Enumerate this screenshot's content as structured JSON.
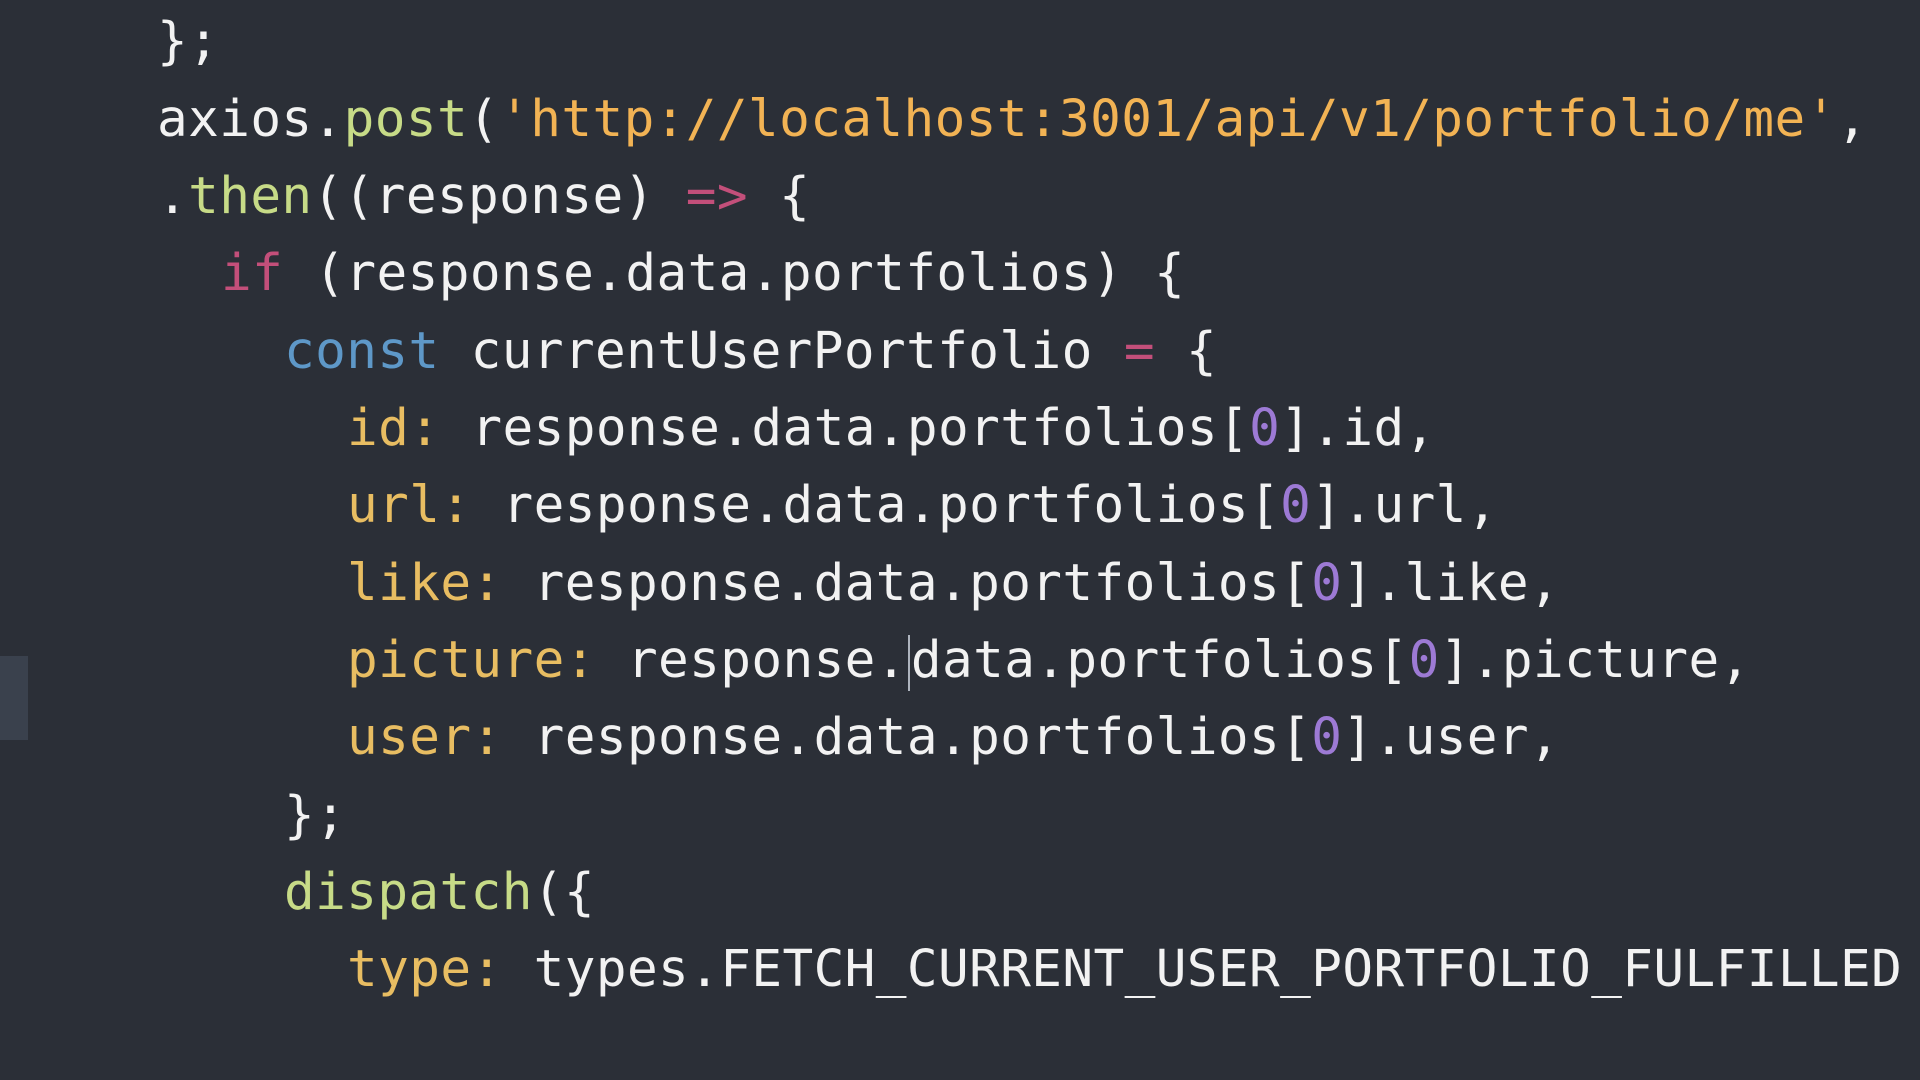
{
  "editor": {
    "name": "code-editor",
    "lines": [
      {
        "tokens": [
          {
            "t": "};",
            "c": "plain"
          }
        ]
      },
      {
        "tokens": [
          {
            "t": "axios.",
            "c": "plain"
          },
          {
            "t": "post",
            "c": "fn"
          },
          {
            "t": "(",
            "c": "plain"
          },
          {
            "t": "'http://localhost:3001/api/v1/portfolio/me'",
            "c": "str"
          },
          {
            "t": ",",
            "c": "plain"
          }
        ]
      },
      {
        "tokens": [
          {
            "t": ".",
            "c": "plain"
          },
          {
            "t": "then",
            "c": "fn"
          },
          {
            "t": "((response) ",
            "c": "plain"
          },
          {
            "t": "=>",
            "c": "kw"
          },
          {
            "t": " {",
            "c": "plain"
          }
        ]
      },
      {
        "tokens": [
          {
            "t": "if",
            "c": "kw"
          },
          {
            "t": " (response.data.portfolios) {",
            "c": "plain"
          }
        ]
      },
      {
        "tokens": [
          {
            "t": "const",
            "c": "decl"
          },
          {
            "t": " currentUserPortfolio ",
            "c": "plain"
          },
          {
            "t": "=",
            "c": "kw"
          },
          {
            "t": " {",
            "c": "plain"
          }
        ]
      },
      {
        "tokens": [
          {
            "t": "id:",
            "c": "prop"
          },
          {
            "t": " response.data.portfolios[",
            "c": "plain"
          },
          {
            "t": "0",
            "c": "num"
          },
          {
            "t": "].id,",
            "c": "plain"
          }
        ]
      },
      {
        "tokens": [
          {
            "t": "url:",
            "c": "prop"
          },
          {
            "t": " response.data.portfolios[",
            "c": "plain"
          },
          {
            "t": "0",
            "c": "num"
          },
          {
            "t": "].url,",
            "c": "plain"
          }
        ]
      },
      {
        "tokens": [
          {
            "t": "like:",
            "c": "prop"
          },
          {
            "t": " response.data.portfolios[",
            "c": "plain"
          },
          {
            "t": "0",
            "c": "num"
          },
          {
            "t": "].like,",
            "c": "plain"
          }
        ]
      },
      {
        "tokens": [
          {
            "t": "picture:",
            "c": "prop"
          },
          {
            "t": " response.",
            "c": "plain"
          },
          {
            "t": "",
            "c": "cursor"
          },
          {
            "t": "data.portfolios[",
            "c": "plain"
          },
          {
            "t": "0",
            "c": "num"
          },
          {
            "t": "].picture,",
            "c": "plain"
          }
        ]
      },
      {
        "tokens": [
          {
            "t": "user:",
            "c": "prop"
          },
          {
            "t": " response.data.portfolios[",
            "c": "plain"
          },
          {
            "t": "0",
            "c": "num"
          },
          {
            "t": "].user,",
            "c": "plain"
          }
        ]
      },
      {
        "tokens": [
          {
            "t": "};",
            "c": "plain"
          }
        ]
      },
      {
        "tokens": [
          {
            "t": "dispatch",
            "c": "fn"
          },
          {
            "t": "({",
            "c": "plain"
          }
        ]
      },
      {
        "tokens": [
          {
            "t": "type:",
            "c": "prop"
          },
          {
            "t": " types.FETCH_CURRENT_USER_PORTFOLIO_FULFILLED",
            "c": "plain"
          }
        ]
      }
    ]
  },
  "colors": {
    "background": "#2b2f37",
    "plain": "#f2f2f2",
    "function": "#c7db87",
    "string": "#f2b354",
    "keyword": "#c34f7a",
    "declaration": "#5e98c8",
    "property": "#e8bd62",
    "number": "#9d7ad5"
  }
}
